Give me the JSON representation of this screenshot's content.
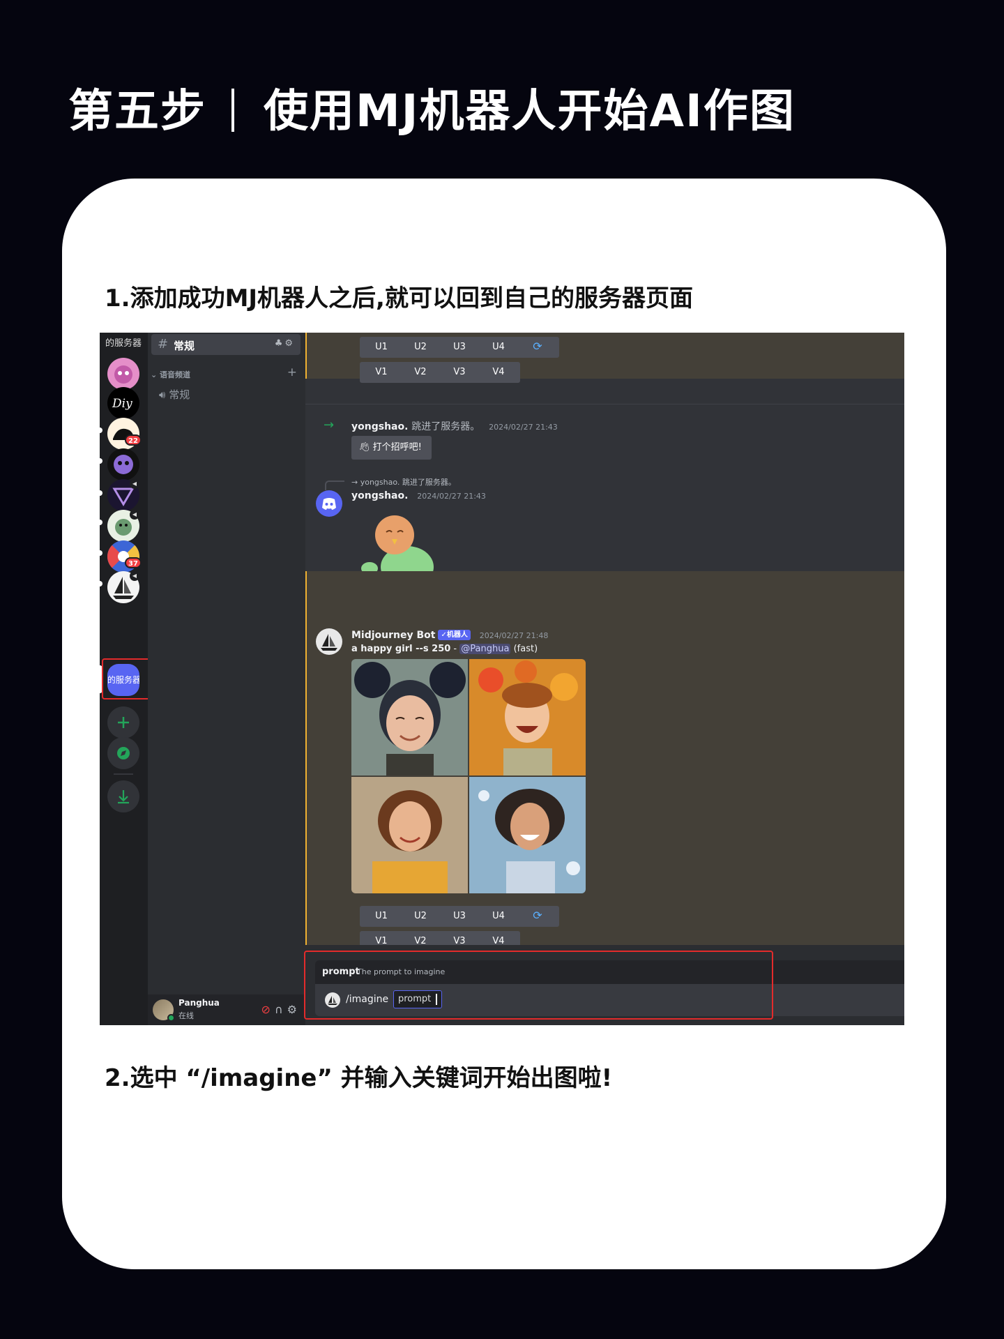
{
  "page": {
    "title_left": "第五步",
    "title_right": "使用MJ机器人开始AI作图",
    "step1": "1.添加成功MJ机器人之后,就可以回到自己的服务器页面",
    "step2": "2.选中 “/imagine” 并输入关键词开始出图啦!"
  },
  "discord": {
    "rail": {
      "top_server_label": "的服务器",
      "my_server_label": "的服务器",
      "badges": [
        "22",
        "37"
      ],
      "icons": [
        "add-server-icon",
        "explore-icon",
        "download-icon"
      ]
    },
    "channels": {
      "active_channel": "常规",
      "active_icons": "♣⚙",
      "category": "语音频道",
      "voice_channel": "常规"
    },
    "user": {
      "name": "Panghua",
      "status": "在线"
    },
    "upscale_buttons": [
      "U1",
      "U2",
      "U3",
      "U4"
    ],
    "variation_buttons": [
      "V1",
      "V2",
      "V3",
      "V4"
    ],
    "join_message": {
      "user": "yongshao.",
      "text": "跳进了服务器。",
      "time": "2024/02/27 21:43",
      "wave_label": "打个招呼吧!"
    },
    "sticker_message": {
      "reply_user": "yongshao.",
      "reply_text": "跳进了服务器。",
      "user": "yongshao.",
      "time": "2024/02/27 21:43"
    },
    "bot_message": {
      "bot_name": "Midjourney Bot",
      "bot_tag": "✓机器人",
      "time": "2024/02/27 21:48",
      "prompt_bold": "a happy girl --s 250",
      "dash": " - ",
      "mention": "@Panghua",
      "speed": "(fast)"
    },
    "command": {
      "option_name": "prompt",
      "option_desc": "The prompt to imagine",
      "name": "/imagine",
      "field_value": "prompt"
    },
    "colors": {
      "blurple": "#5865f2",
      "highlight_border": "#e32b2b",
      "online": "#23a55a"
    }
  }
}
